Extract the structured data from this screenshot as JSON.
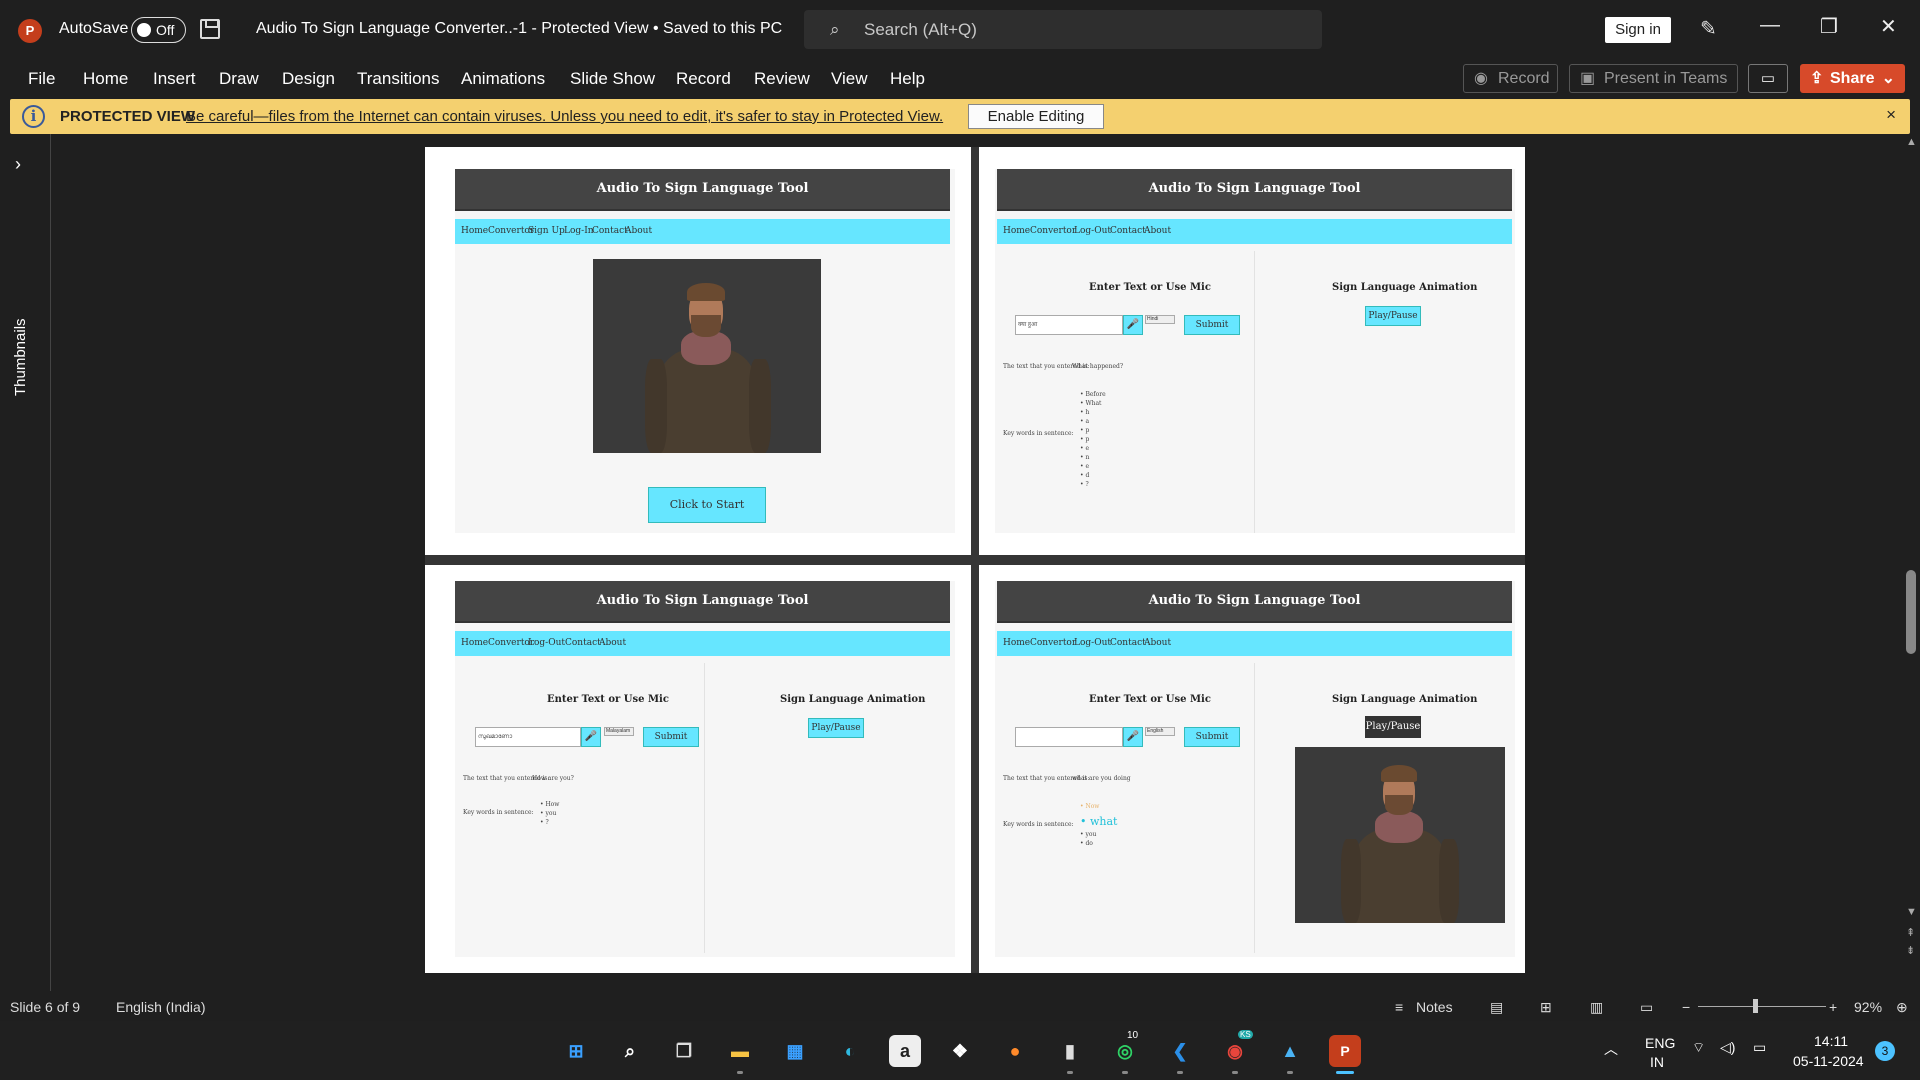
{
  "app": {
    "logo": "P",
    "autosave_label": "AutoSave",
    "autosave_state": "Off",
    "document_title": "Audio To Sign Language Converter..-1  -  Protected View • Saved to this PC",
    "search_placeholder": "Search (Alt+Q)",
    "sign_in": "Sign in",
    "icons": [
      "save-icon",
      "search-icon",
      "pen-icon",
      "minimize-icon",
      "restore-icon",
      "close-icon"
    ]
  },
  "menu": [
    "File",
    "Home",
    "Insert",
    "Draw",
    "Design",
    "Transitions",
    "Animations",
    "Slide Show",
    "Record",
    "Review",
    "View",
    "Help"
  ],
  "ribbon_right": {
    "record": "Record",
    "present": "Present in Teams",
    "share": "Share"
  },
  "protected_view": {
    "title": "PROTECTED VIEW",
    "message": "Be careful—files from the Internet can contain viruses. Unless you need to edit, it's safer to stay in Protected View.",
    "enable_button": "Enable Editing",
    "close": "×"
  },
  "thumbnails_label": "Thumbnails",
  "slide": {
    "site_title": "Audio To Sign Language Tool",
    "nav_home_page": [
      "Home",
      "Convertor",
      "Sign Up",
      "Log-In",
      "Contact",
      "About"
    ],
    "nav_logged_in": [
      "Home",
      "Convertor",
      "Log-Out",
      "Contact",
      "About"
    ],
    "click_to_start": "Click to Start",
    "enter_text_title": "Enter Text or Use Mic",
    "sign_anim_title": "Sign Language Animation",
    "submit": "Submit",
    "play_pause": "Play/Pause",
    "text_entered_label": "The text that you entered is:",
    "keywords_label": "Key words in sentence:",
    "tr": {
      "input_value": "क्या हुआ",
      "lang": "Hindi",
      "entered": "What happened?",
      "keywords": [
        "Before",
        "What",
        "h",
        "a",
        "p",
        "p",
        "e",
        "n",
        "e",
        "d",
        "?"
      ]
    },
    "bl": {
      "input_value": "സുഖമാണോ",
      "lang": "Malayalam",
      "entered": "How are you?",
      "keywords": [
        "How",
        "you",
        "?"
      ]
    },
    "br": {
      "input_value": "",
      "lang": "English",
      "entered": "what are you doing",
      "keywords": [
        "Now",
        "what",
        "you",
        "do"
      ]
    }
  },
  "status": {
    "slide": "Slide 6 of 9",
    "language": "English (India)",
    "notes": "Notes",
    "zoom": "92%"
  },
  "taskbar": {
    "apps": [
      "start",
      "search",
      "task-view",
      "file-explorer",
      "store",
      "edge",
      "amazon",
      "dropbox",
      "firefox",
      "terminal",
      "whatsapp",
      "vscode",
      "chrome",
      "photos",
      "powerpoint"
    ],
    "whatsapp_badge": "10",
    "chrome_badge": "KS",
    "lang_top": "ENG",
    "lang_bottom": "IN",
    "time": "14:11",
    "date": "05-11-2024",
    "notif_count": "3"
  }
}
